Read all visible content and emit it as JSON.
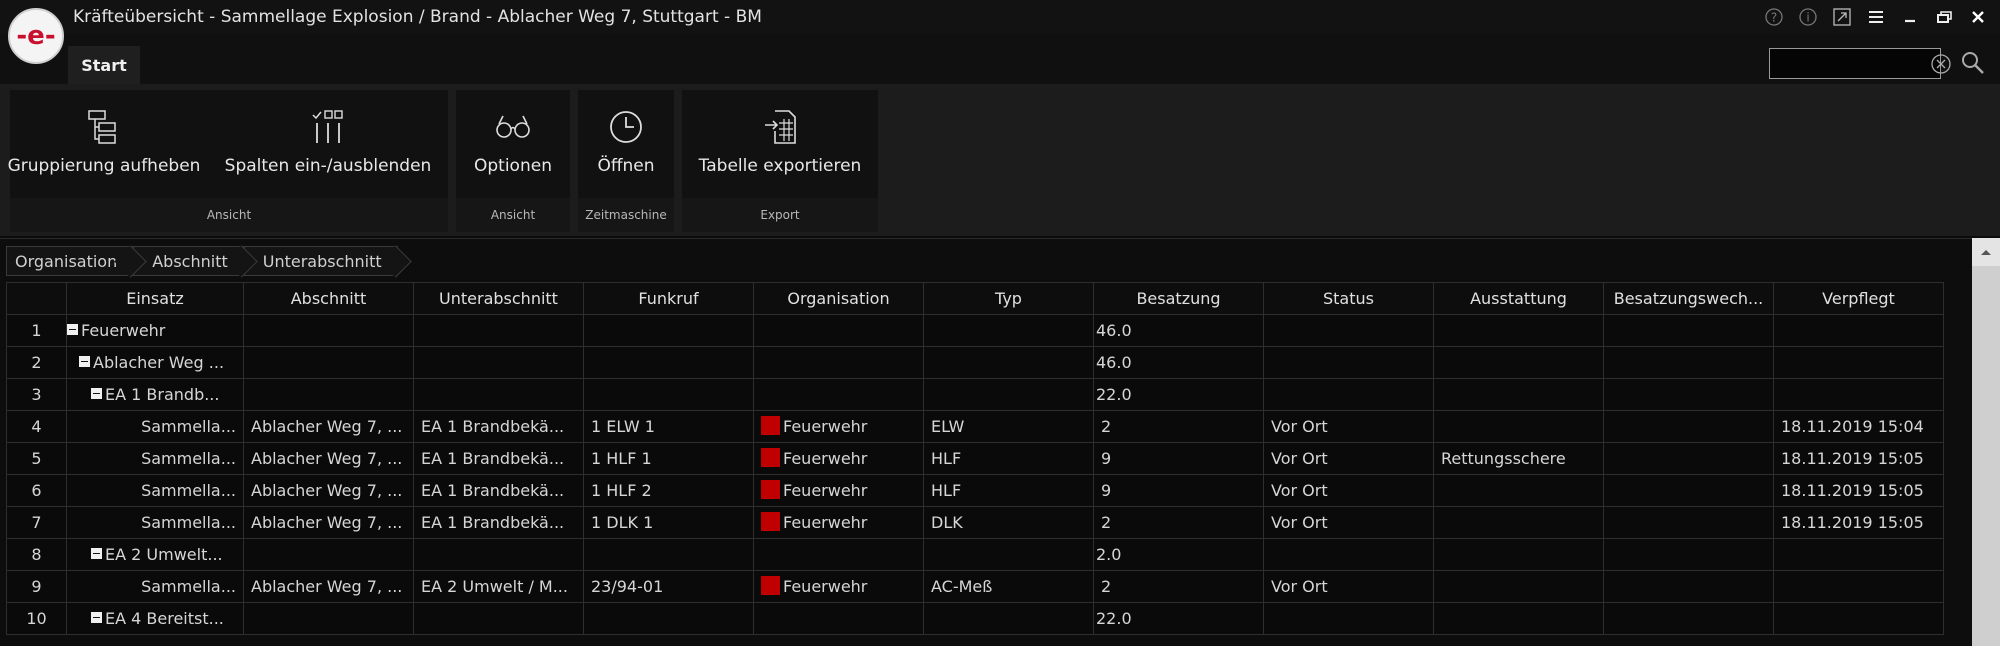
{
  "window": {
    "title": "Kräfteübersicht - Sammellage Explosion / Brand - Ablacher Weg 7, Stuttgart - BM",
    "logo_text": "-e-"
  },
  "tabs": {
    "start": "Start"
  },
  "search": {
    "value": "",
    "placeholder": ""
  },
  "ribbon": {
    "groups": [
      {
        "label": "Ansicht",
        "buttons": [
          "Gruppierung aufheben",
          "Spalten ein-/ausblenden"
        ]
      },
      {
        "label": "Ansicht",
        "buttons": [
          "Optionen"
        ]
      },
      {
        "label": "Zeitmaschine",
        "buttons": [
          "Öffnen"
        ]
      },
      {
        "label": "Export",
        "buttons": [
          "Tabelle exportieren"
        ]
      }
    ]
  },
  "breadcrumb": [
    "Organisation",
    "Abschnitt",
    "Unterabschnitt"
  ],
  "columns": [
    "Einsatz",
    "Abschnitt",
    "Unterabschnitt",
    "Funkruf",
    "Organisation",
    "Typ",
    "Besatzung",
    "Status",
    "Ausstattung",
    "Besatzungswech...",
    "Verpflegt"
  ],
  "rows": [
    {
      "n": "1",
      "level": 0,
      "group": "Feuerwehr",
      "besatzung": "46.0"
    },
    {
      "n": "2",
      "level": 1,
      "group": "Ablacher Weg ...",
      "besatzung": "46.0"
    },
    {
      "n": "3",
      "level": 2,
      "group": "EA 1 Brandb...",
      "besatzung": "22.0"
    },
    {
      "n": "4",
      "cells": [
        "Sammella...",
        "Ablacher Weg 7, ...",
        "EA 1 Brandbekä...",
        "1 ELW 1",
        "Feuerwehr",
        "ELW",
        "2",
        "Vor Ort",
        "",
        "",
        "18.11.2019 15:04"
      ]
    },
    {
      "n": "5",
      "cells": [
        "Sammella...",
        "Ablacher Weg 7, ...",
        "EA 1 Brandbekä...",
        "1 HLF 1",
        "Feuerwehr",
        "HLF",
        "9",
        "Vor Ort",
        "Rettungsschere",
        "",
        "18.11.2019 15:05"
      ]
    },
    {
      "n": "6",
      "cells": [
        "Sammella...",
        "Ablacher Weg 7, ...",
        "EA 1 Brandbekä...",
        "1 HLF 2",
        "Feuerwehr",
        "HLF",
        "9",
        "Vor Ort",
        "",
        "",
        "18.11.2019 15:05"
      ]
    },
    {
      "n": "7",
      "cells": [
        "Sammella...",
        "Ablacher Weg 7, ...",
        "EA 1 Brandbekä...",
        "1 DLK 1",
        "Feuerwehr",
        "DLK",
        "2",
        "Vor Ort",
        "",
        "",
        "18.11.2019 15:05"
      ]
    },
    {
      "n": "8",
      "level": 2,
      "group": "EA 2 Umwelt...",
      "besatzung": "2.0"
    },
    {
      "n": "9",
      "cells": [
        "Sammella...",
        "Ablacher Weg 7, ...",
        "EA 2 Umwelt / M...",
        "23/94-01",
        "Feuerwehr",
        "AC-Meß",
        "2",
        "Vor Ort",
        "",
        "",
        ""
      ]
    },
    {
      "n": "10",
      "level": 2,
      "group": "EA 4 Bereitst...",
      "besatzung": "22.0"
    }
  ],
  "colors": {
    "organisation_swatch": "#c00000",
    "background": "#0b0b0b"
  }
}
